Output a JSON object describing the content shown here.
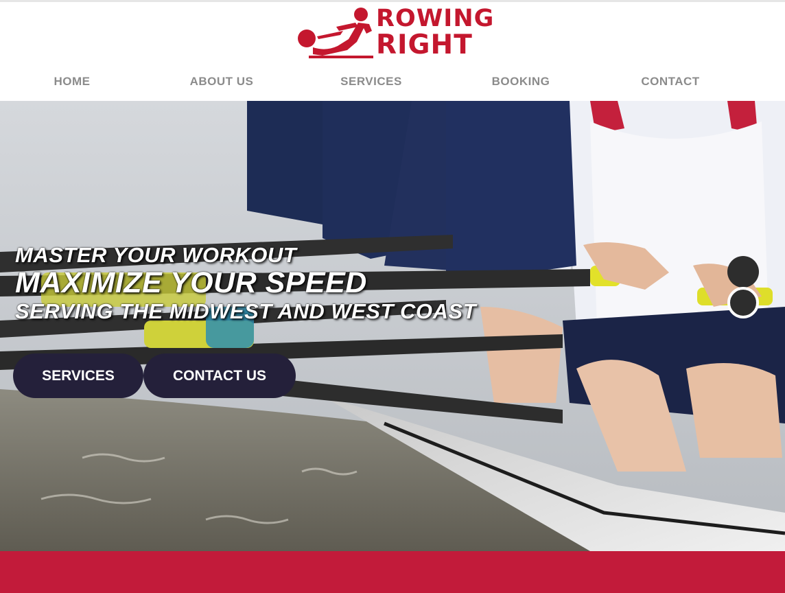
{
  "brand": {
    "logo_line1": "ROWING",
    "logo_line2": "RIGHT",
    "logo_color": "#c4172e"
  },
  "nav": {
    "items": [
      {
        "label": "HOME"
      },
      {
        "label": "ABOUT US"
      },
      {
        "label": "SERVICES"
      },
      {
        "label": "BOOKING"
      },
      {
        "label": "CONTACT"
      }
    ],
    "color": "#8b8b8b"
  },
  "hero": {
    "line1": "MASTER YOUR WORKOUT",
    "line2": "MAXIMIZE YOUR SPEED",
    "line3": "SERVING THE MIDWEST AND WEST COAST",
    "buttons": {
      "services": "SERVICES",
      "contact": "CONTACT US"
    },
    "button_color": "#24203a",
    "slider": {
      "slide_count": 2,
      "active_slide": 1
    }
  },
  "footer": {
    "band_color": "#c21b3a"
  }
}
